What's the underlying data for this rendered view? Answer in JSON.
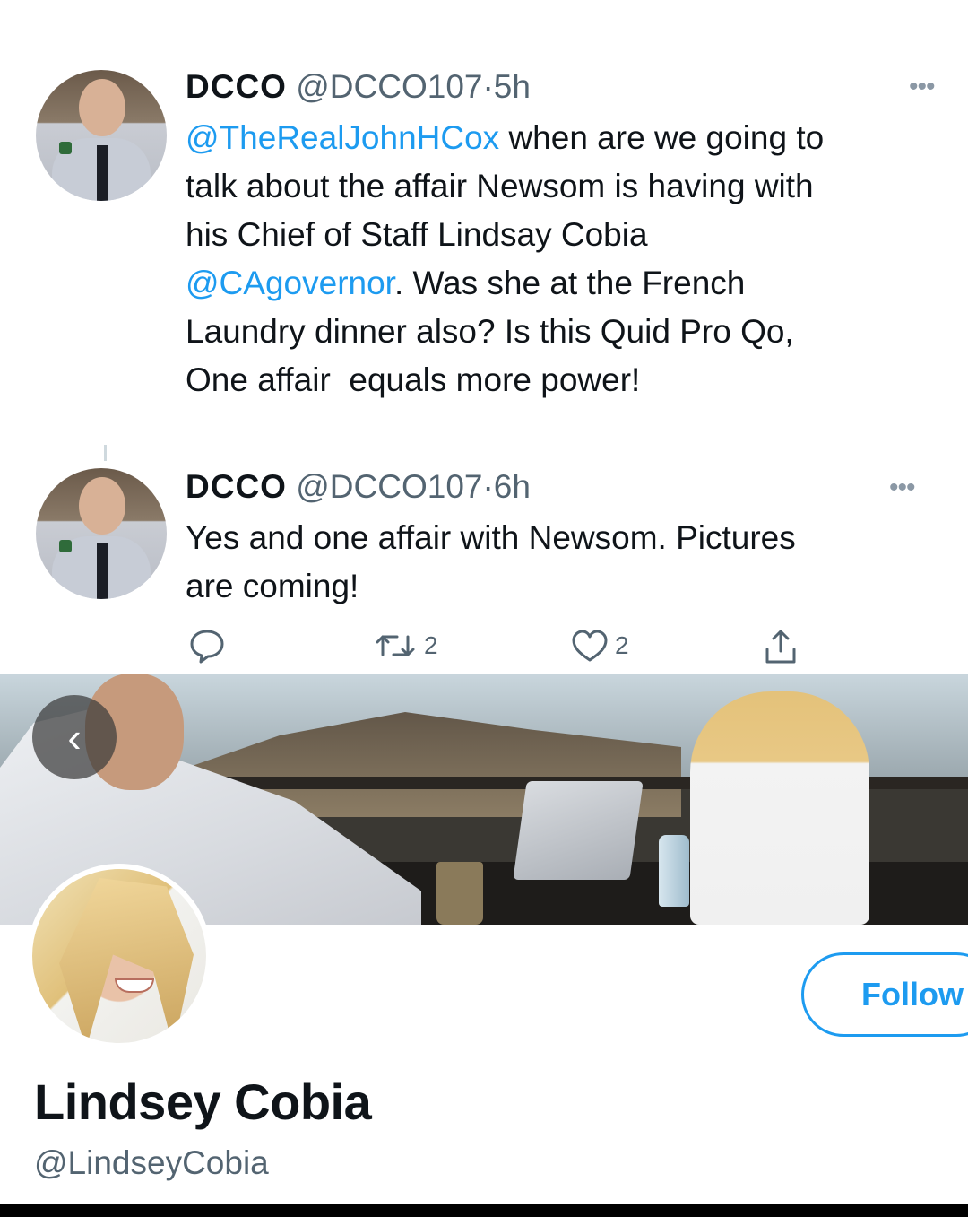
{
  "tweets": [
    {
      "name": "DCCO",
      "handle": "@DCCO107",
      "separator": "·",
      "time": "5h",
      "more": "•••",
      "lines": [
        [
          {
            "text": "@TheRealJohnHCox",
            "mention": true
          },
          {
            "text": " when are we going to",
            "mention": false
          }
        ],
        [
          {
            "text": "talk about the affair Newsom is having with",
            "mention": false
          }
        ],
        [
          {
            "text": "his Chief of Staff Lindsay Cobia",
            "mention": false
          }
        ],
        [
          {
            "text": "@CAgovernor",
            "mention": true
          },
          {
            "text": ". Was she at the French",
            "mention": false
          }
        ],
        [
          {
            "text": "Laundry dinner also? Is this Quid Pro Qo,",
            "mention": false
          }
        ],
        [
          {
            "text": "One affair  equals more power!",
            "mention": false
          }
        ]
      ]
    },
    {
      "name": "DCCO",
      "handle": "@DCCO107",
      "separator": "·",
      "time": "6h",
      "more": "•••",
      "lines": [
        [
          {
            "text": "Yes and one affair with Newsom. Pictures",
            "mention": false
          }
        ],
        [
          {
            "text": "are coming!",
            "mention": false
          }
        ]
      ],
      "actions": {
        "reply_count": "",
        "retweet_count": "2",
        "like_count": "2"
      }
    }
  ],
  "profile": {
    "carousel_back": "‹",
    "follow_label": "Follow",
    "display_name": "Lindsey Cobia",
    "handle": "@LindseyCobia"
  },
  "colors": {
    "mention": "#1d9bf0",
    "secondary_text": "#536471",
    "follow_border": "#1d9bf0"
  },
  "icons": [
    "reply-icon",
    "retweet-icon",
    "like-icon",
    "share-icon",
    "chevron-left-icon",
    "more-icon"
  ]
}
